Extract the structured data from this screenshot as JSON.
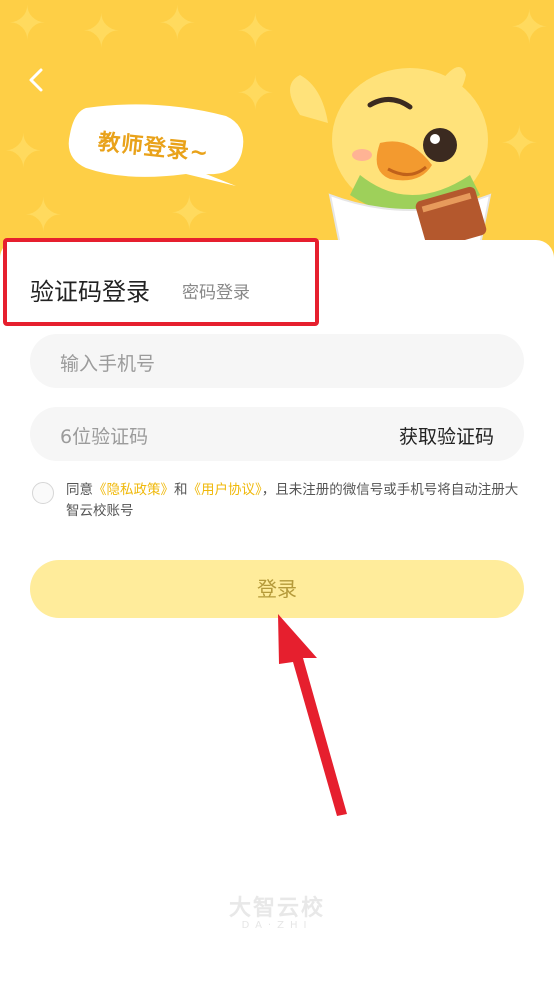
{
  "header": {
    "back_icon": "chevron-left-icon",
    "bubble_text": "教师登录~",
    "mascot": "duck-mascot-illustration"
  },
  "tabs": {
    "active_label": "验证码登录",
    "inactive_label": "密码登录"
  },
  "form": {
    "phone_placeholder": "输入手机号",
    "code_placeholder": "6位验证码",
    "get_code_label": "获取验证码"
  },
  "agreement": {
    "prefix": "同意",
    "privacy_link": "《隐私政策》",
    "and": "和",
    "user_link": "《用户协议》",
    "suffix": "，且未注册的微信号或手机号将自动注册大智云校账号"
  },
  "login": {
    "button_label": "登录"
  },
  "footer": {
    "logo_text": "大智云校",
    "logo_sub": "DA·ZHI"
  },
  "colors": {
    "hero_bg": "#fecf46",
    "accent_link": "#f0b90b",
    "login_button_bg": "#ffec9b",
    "highlight_red": "#e61f2e"
  }
}
